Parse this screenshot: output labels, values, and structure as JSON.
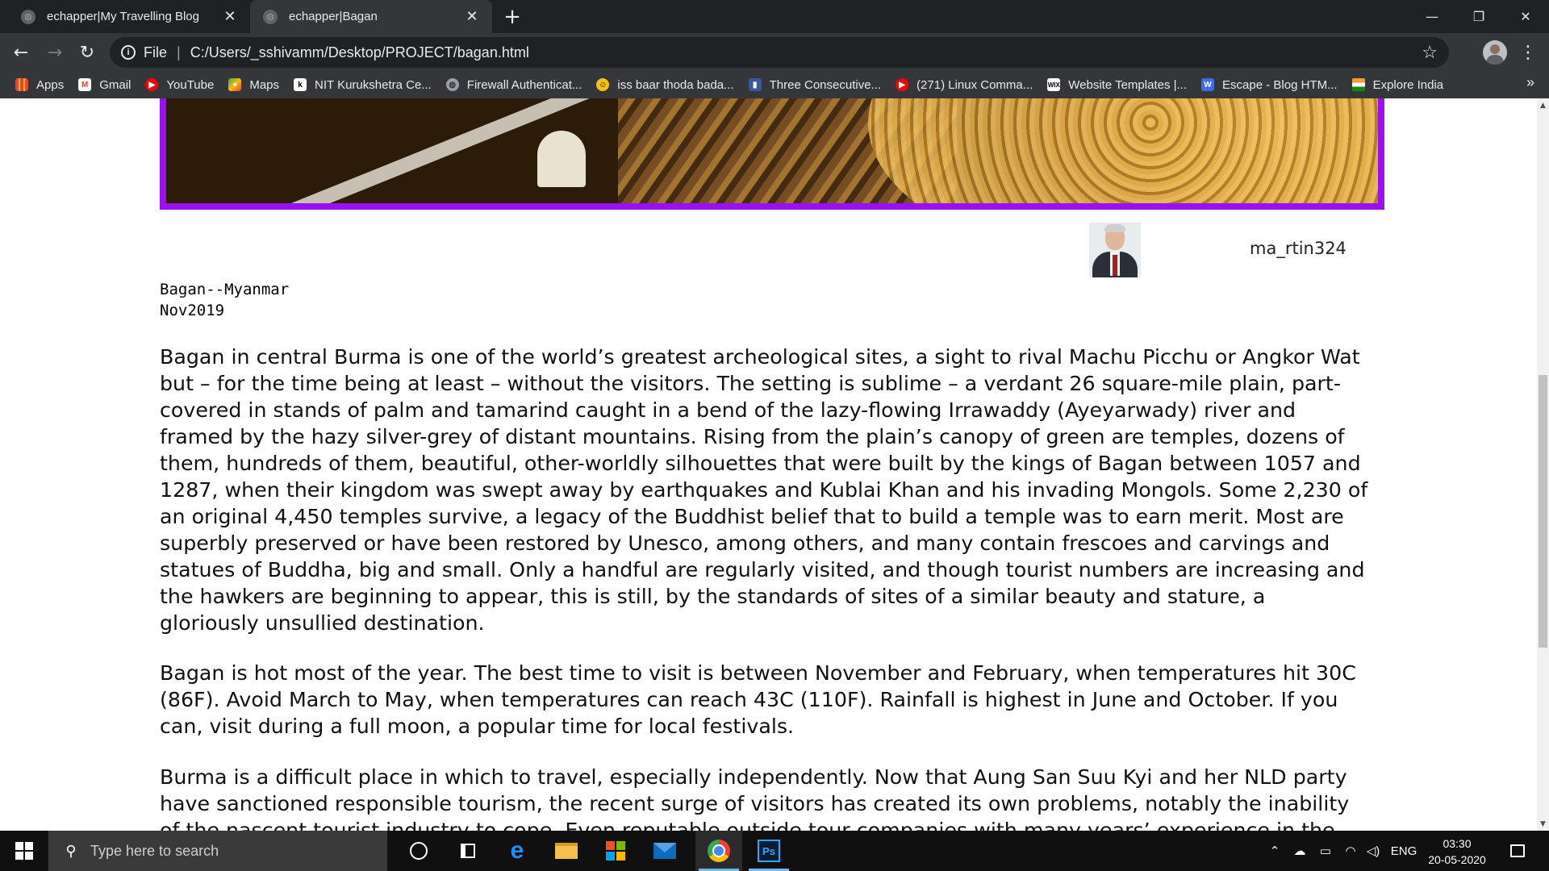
{
  "browser": {
    "tabs": [
      {
        "label": "echapper|My Travelling Blog",
        "active": false
      },
      {
        "label": "echapper|Bagan",
        "active": true
      }
    ],
    "new_tab": "+",
    "window_controls": {
      "minimize": "—",
      "restore": "❐",
      "close": "✕"
    },
    "address": {
      "scheme_label": "File",
      "url": "C:/Users/_sshivamm/Desktop/PROJECT/bagan.html"
    },
    "bookmarks": [
      {
        "label": "Apps",
        "icon": "apps-grid-icon",
        "color": "#4285f4"
      },
      {
        "label": "Gmail",
        "icon": "gmail-icon",
        "color": "#ea4335"
      },
      {
        "label": "YouTube",
        "icon": "youtube-icon",
        "color": "#ff0000"
      },
      {
        "label": "Maps",
        "icon": "maps-icon",
        "color": "#34a853"
      },
      {
        "label": "NIT Kurukshetra Ce...",
        "icon": "nit-icon",
        "color": "#ffffff"
      },
      {
        "label": "Firewall Authenticat...",
        "icon": "globe-icon",
        "color": "#9aa0a6"
      },
      {
        "label": "iss baar thoda bada...",
        "icon": "smiley-icon",
        "color": "#f4c20d"
      },
      {
        "label": "Three Consecutive...",
        "icon": "bookmark-page-icon",
        "color": "#3b5998"
      },
      {
        "label": "(271) Linux Comma...",
        "icon": "youtube-icon",
        "color": "#ff0000"
      },
      {
        "label": "Website Templates |...",
        "icon": "wix-icon",
        "color": "#ffffff"
      },
      {
        "label": "Escape - Blog HTM...",
        "icon": "w-logo-icon",
        "color": "#3a6ee8"
      },
      {
        "label": "Explore India",
        "icon": "india-flag-icon",
        "color": "#ff9933"
      }
    ],
    "bookmarks_more": "»"
  },
  "page": {
    "banner_border_color": "#9b10f0",
    "author": {
      "name": "ma_rtin324"
    },
    "location": "Bagan--Myanmar",
    "date": "Nov2019",
    "paragraphs": [
      "Bagan in central Burma is one of the world’s greatest archeological sites, a sight to rival Machu Picchu or Angkor Wat but – for the time being at least – without the visitors. The setting is sublime – a verdant 26 square-mile plain, part-covered in stands of palm and tamarind caught in a bend of the lazy-flowing Irrawaddy (Ayeyarwady) river and framed by the hazy silver-grey of distant mountains. Rising from the plain’s canopy of green are temples, dozens of them, hundreds of them, beautiful, other-worldly silhouettes that were built by the kings of Bagan between 1057 and 1287, when their kingdom was swept away by earthquakes and Kublai Khan and his invading Mongols. Some 2,230 of an original 4,450 temples survive, a legacy of the Buddhist belief that to build a temple was to earn merit. Most are superbly preserved or have been restored by Unesco, among others, and many contain frescoes and carvings and statues of Buddha, big and small. Only a handful are regularly visited, and though tourist numbers are increasing and the hawkers are beginning to appear, this is still, by the standards of sites of a similar beauty and stature, a gloriously unsullied destination.",
      "Bagan is hot most of the year. The best time to visit is between November and February, when temperatures hit 30C (86F). Avoid March to May, when temperatures can reach 43C (110F). Rainfall is highest in June and October. If you can, visit during a full moon, a popular time for local festivals.",
      "Burma is a difficult place in which to travel, especially independently. Now that Aung San Suu Kyi and her NLD party have sanctioned responsible tourism, the recent surge of visitors has created its own problems, notably the inability of the nascent tourist industry to cope. Even reputable outside tour companies with many years’ experience in the"
    ]
  },
  "taskbar": {
    "search_placeholder": "Type here to search",
    "apps": [
      {
        "name": "cortana-icon"
      },
      {
        "name": "task-view-icon"
      },
      {
        "name": "edge-icon"
      },
      {
        "name": "file-explorer-icon"
      },
      {
        "name": "store-icon"
      },
      {
        "name": "mail-icon"
      },
      {
        "name": "chrome-icon"
      },
      {
        "name": "photoshop-icon"
      }
    ],
    "photoshop_label": "Ps",
    "tray": {
      "language": "ENG",
      "time": "03:30",
      "date": "20-05-2020"
    }
  }
}
